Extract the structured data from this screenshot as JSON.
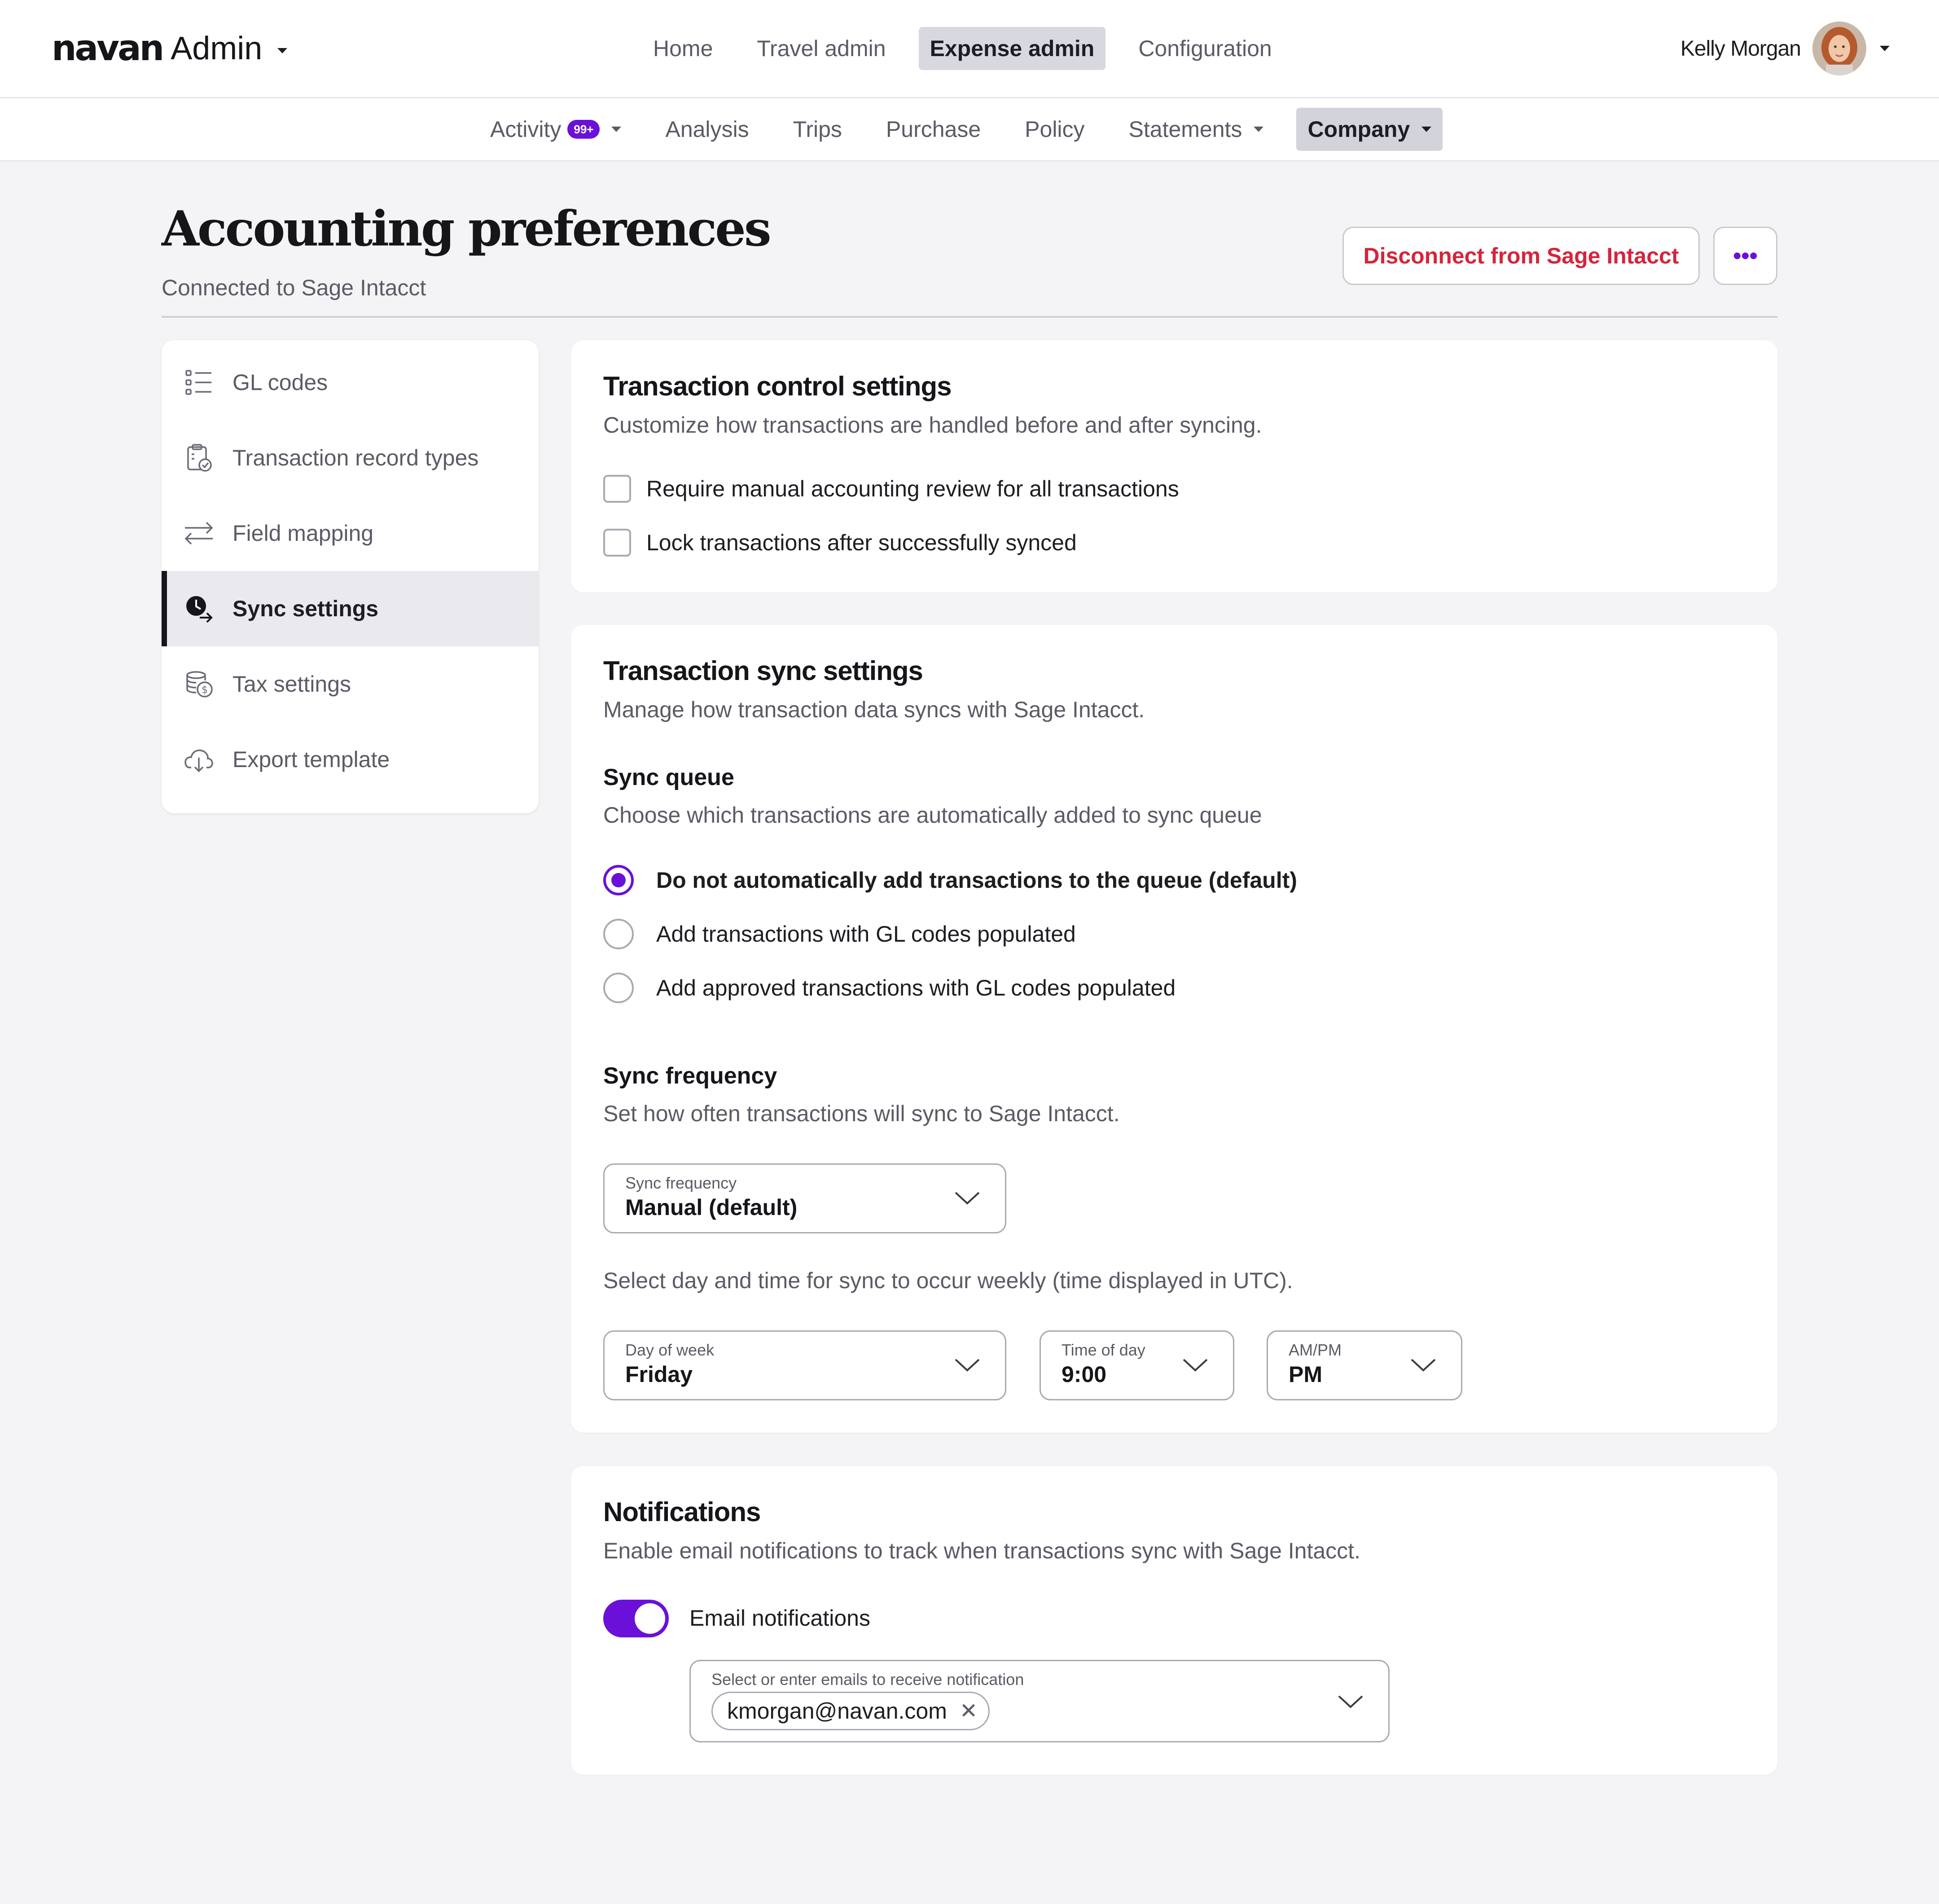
{
  "app": {
    "logo_word": "navan",
    "logo_suffix": "Admin",
    "top_nav": [
      {
        "label": "Home",
        "active": false
      },
      {
        "label": "Travel admin",
        "active": false
      },
      {
        "label": "Expense admin",
        "active": true
      },
      {
        "label": "Configuration",
        "active": false
      }
    ],
    "user_name": "Kelly Morgan"
  },
  "sub_nav": {
    "activity_label": "Activity",
    "activity_badge": "99+",
    "items": [
      "Analysis",
      "Trips",
      "Purchase",
      "Policy"
    ],
    "statements_label": "Statements",
    "company_label": "Company"
  },
  "page": {
    "title": "Accounting preferences",
    "subtitle": "Connected to Sage Intacct",
    "disconnect_button": "Disconnect from Sage Intacct",
    "more_button": "•••"
  },
  "sidebar": {
    "items": [
      {
        "label": "GL codes",
        "icon": "list-icon",
        "active": false
      },
      {
        "label": "Transaction record types",
        "icon": "clipboard-check-icon",
        "active": false
      },
      {
        "label": "Field mapping",
        "icon": "arrows-swap-icon",
        "active": false
      },
      {
        "label": "Sync settings",
        "icon": "clock-sync-icon",
        "active": true
      },
      {
        "label": "Tax settings",
        "icon": "coins-icon",
        "active": false
      },
      {
        "label": "Export template",
        "icon": "cloud-download-icon",
        "active": false
      }
    ]
  },
  "control": {
    "title": "Transaction control settings",
    "desc": "Customize how transactions are handled before and after syncing.",
    "options": [
      {
        "label": "Require manual accounting review for all transactions",
        "checked": false
      },
      {
        "label": "Lock transactions after successfully synced",
        "checked": false
      }
    ]
  },
  "sync": {
    "title": "Transaction sync settings",
    "desc": "Manage how transaction data syncs with Sage Intacct.",
    "queue_title": "Sync queue",
    "queue_desc": "Choose which transactions are automatically added to sync queue",
    "queue_options": [
      {
        "label": "Do not automatically add transactions to the queue (default)",
        "selected": true
      },
      {
        "label": "Add transactions with GL codes populated",
        "selected": false
      },
      {
        "label": "Add approved transactions with GL codes populated",
        "selected": false
      }
    ],
    "freq_title": "Sync frequency",
    "freq_desc": "Set how often transactions will sync to Sage Intacct.",
    "freq_select": {
      "label": "Sync frequency",
      "value": "Manual (default)"
    },
    "weekly_desc": "Select day and time for sync to occur weekly (time displayed in UTC).",
    "day_select": {
      "label": "Day of week",
      "value": "Friday"
    },
    "time_select": {
      "label": "Time of day",
      "value": "9:00"
    },
    "ampm_select": {
      "label": "AM/PM",
      "value": "PM"
    }
  },
  "notifications": {
    "title": "Notifications",
    "desc": "Enable email notifications to track when transactions sync with Sage Intacct.",
    "email_toggle_label": "Email notifications",
    "email_toggle_on": true,
    "email_field_label": "Select or enter emails to receive notification",
    "email_chips": [
      "kmorgan@navan.com"
    ],
    "chip_remove": "✕"
  },
  "colors": {
    "accent": "#6a10d9",
    "danger": "#d6243b",
    "background": "#f4f4f6"
  }
}
